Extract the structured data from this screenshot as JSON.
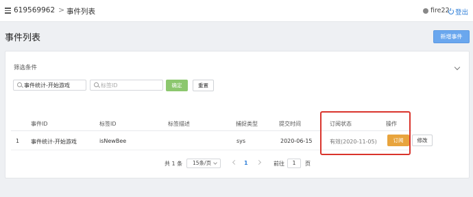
{
  "header": {
    "project_id": "619569962",
    "separator": ">",
    "breadcrumb": "事件列表",
    "username": "fire22",
    "logout_label": "登出"
  },
  "page": {
    "title": "事件列表",
    "add_button": "新增事件"
  },
  "filter": {
    "title": "筛选条件",
    "event_search_value": "事件统计-开始游戏",
    "tag_search_placeholder": "标签ID",
    "confirm_label": "确定",
    "reset_label": "重置"
  },
  "table": {
    "columns": [
      "事件ID",
      "标签ID",
      "标签描述",
      "捕捉类型",
      "提交时间",
      "订阅状态",
      "操作"
    ],
    "rows": [
      {
        "index": "1",
        "event_id": "事件统计-开始游戏",
        "tag_id": "isNewBee",
        "tag_desc": "",
        "capture_type": "sys",
        "submit_time": "2020-06-15",
        "status": "有效(2020-11-05)",
        "subscribe_label": "订阅",
        "edit_label": "修改"
      }
    ]
  },
  "pagination": {
    "total_text": "共 1 条",
    "page_size": "15条/页",
    "current_page": "1",
    "goto_label": "前往",
    "goto_value": "1",
    "page_suffix": "页"
  },
  "colors": {
    "accent": "#6aa7ee",
    "confirm": "#8cc76e",
    "subscribe": "#e8a43d",
    "highlight_box": "#d9332b",
    "link": "#2f7fd8"
  }
}
